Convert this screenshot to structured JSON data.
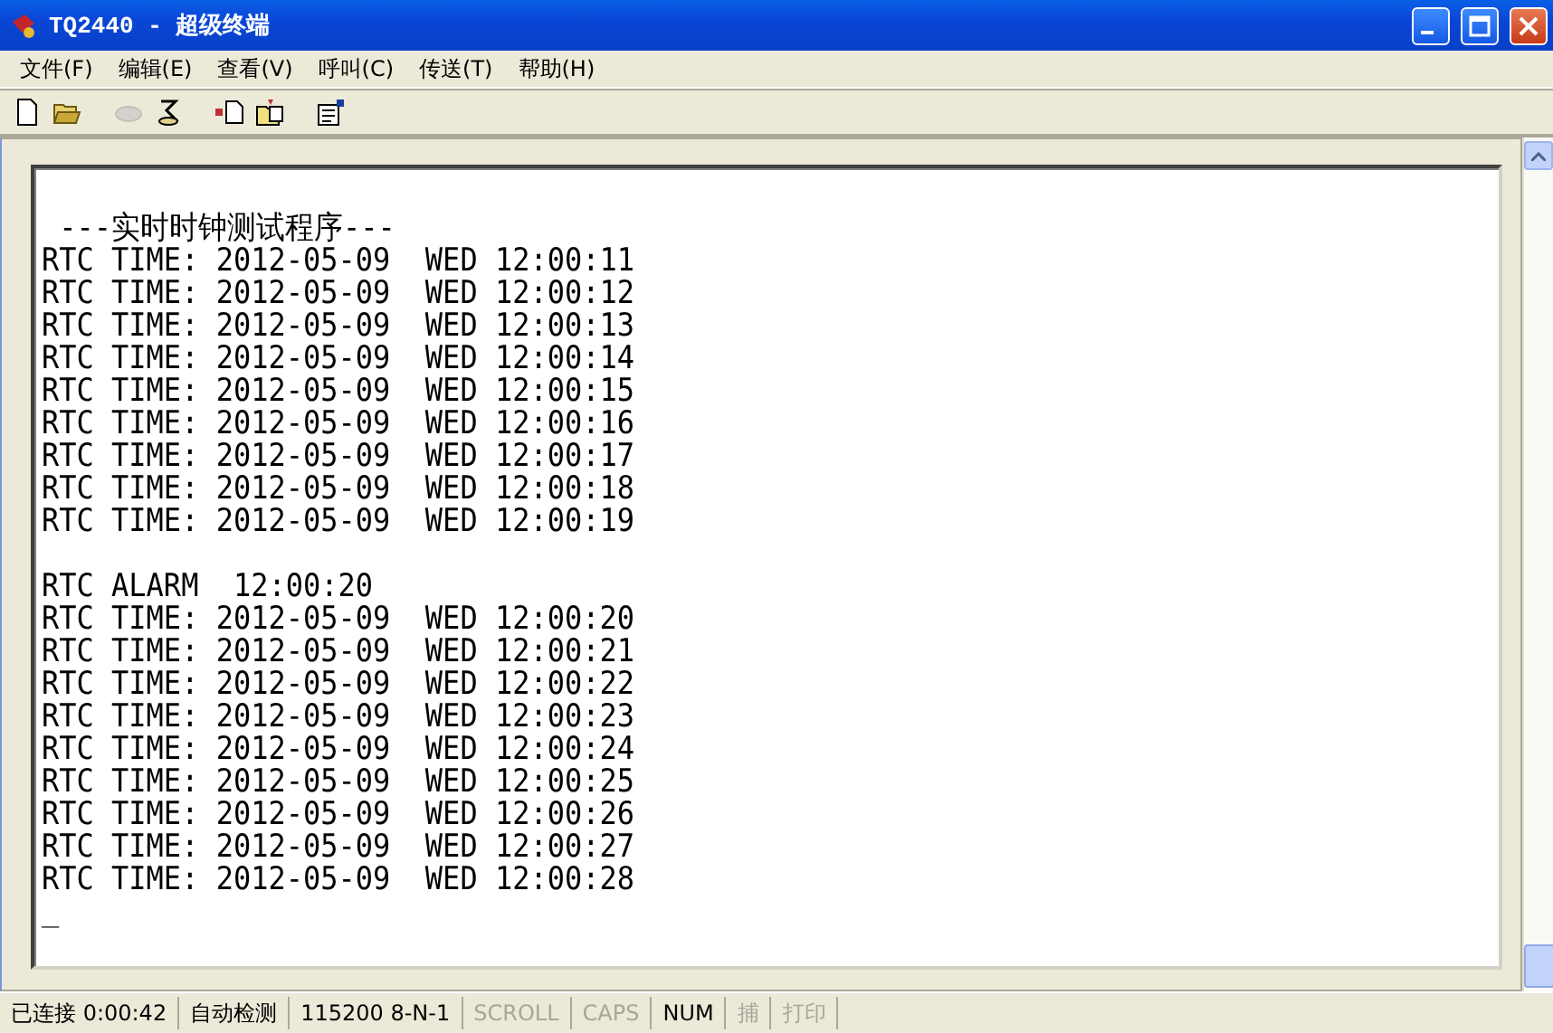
{
  "window": {
    "title": "TQ2440 - 超级终端"
  },
  "menu": [
    {
      "label": "文件(F)"
    },
    {
      "label": "编辑(E)"
    },
    {
      "label": "查看(V)"
    },
    {
      "label": "呼叫(C)"
    },
    {
      "label": "传送(T)"
    },
    {
      "label": "帮助(H)"
    }
  ],
  "toolbar": [
    {
      "kind": "new",
      "disabled": false
    },
    {
      "kind": "open",
      "disabled": false
    },
    {
      "kind": "sep"
    },
    {
      "kind": "disconnect",
      "disabled": true
    },
    {
      "kind": "dial",
      "disabled": false
    },
    {
      "kind": "sep"
    },
    {
      "kind": "send",
      "disabled": false
    },
    {
      "kind": "receive",
      "disabled": false
    },
    {
      "kind": "sep"
    },
    {
      "kind": "properties",
      "disabled": false
    }
  ],
  "terminal": {
    "blocks": [
      [
        " ---实时时钟测试程序---",
        "RTC TIME: 2012-05-09  WED 12:00:11",
        "RTC TIME: 2012-05-09  WED 12:00:12",
        "RTC TIME: 2012-05-09  WED 12:00:13",
        "RTC TIME: 2012-05-09  WED 12:00:14",
        "RTC TIME: 2012-05-09  WED 12:00:15",
        "RTC TIME: 2012-05-09  WED 12:00:16",
        "RTC TIME: 2012-05-09  WED 12:00:17",
        "RTC TIME: 2012-05-09  WED 12:00:18",
        "RTC TIME: 2012-05-09  WED 12:00:19"
      ],
      [
        "RTC ALARM  12:00:20",
        "RTC TIME: 2012-05-09  WED 12:00:20",
        "RTC TIME: 2012-05-09  WED 12:00:21",
        "RTC TIME: 2012-05-09  WED 12:00:22",
        "RTC TIME: 2012-05-09  WED 12:00:23",
        "RTC TIME: 2012-05-09  WED 12:00:24",
        "RTC TIME: 2012-05-09  WED 12:00:25",
        "RTC TIME: 2012-05-09  WED 12:00:26",
        "RTC TIME: 2012-05-09  WED 12:00:27",
        "RTC TIME: 2012-05-09  WED 12:00:28"
      ]
    ],
    "cursor": "_"
  },
  "status_bar": [
    {
      "text": "已连接 0:00:42",
      "disabled": false
    },
    {
      "text": "自动检测",
      "disabled": false
    },
    {
      "text": "115200 8-N-1",
      "disabled": false
    },
    {
      "text": "SCROLL",
      "disabled": true
    },
    {
      "text": "CAPS",
      "disabled": true
    },
    {
      "text": "NUM",
      "disabled": false
    },
    {
      "text": "捕",
      "disabled": true
    },
    {
      "text": "打印",
      "disabled": true
    }
  ]
}
